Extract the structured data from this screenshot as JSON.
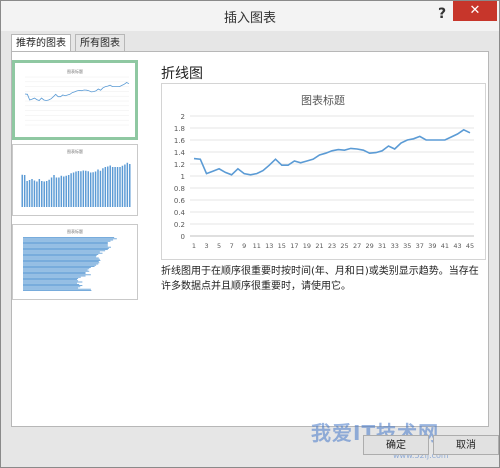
{
  "dialog": {
    "title": "插入图表",
    "help_label": "?",
    "close_label": "✕"
  },
  "tabs": [
    {
      "label": "推荐的图表",
      "active": true
    },
    {
      "label": "所有图表",
      "active": false
    }
  ],
  "thumbnails": [
    {
      "type": "line",
      "title": "图表标题",
      "selected": true
    },
    {
      "type": "column",
      "title": "图表标题",
      "selected": false
    },
    {
      "type": "bar",
      "title": "图表标题",
      "selected": false
    }
  ],
  "preview": {
    "chart_type_name": "折线图",
    "description": "折线图用于在顺序很重要时按时间(年、月和日)或类别显示趋势。当存在许多数据点并且顺序很重要时，请使用它。"
  },
  "chart_data": {
    "type": "line",
    "title": "图表标题",
    "xlabel": "",
    "ylabel": "",
    "x": [
      1,
      2,
      3,
      4,
      5,
      6,
      7,
      8,
      9,
      10,
      11,
      12,
      13,
      14,
      15,
      16,
      17,
      18,
      19,
      20,
      21,
      22,
      23,
      24,
      25,
      26,
      27,
      28,
      29,
      30,
      31,
      32,
      33,
      34,
      35,
      36,
      37,
      38,
      39,
      40,
      41,
      42,
      43,
      44,
      45
    ],
    "x_tick_labels": [
      "1",
      "3",
      "5",
      "7",
      "9",
      "11",
      "13",
      "15",
      "17",
      "19",
      "21",
      "23",
      "25",
      "27",
      "29",
      "31",
      "33",
      "35",
      "37",
      "39",
      "41",
      "43",
      "45"
    ],
    "y_tick_labels": [
      "0",
      "0.2",
      "0.4",
      "0.6",
      "0.8",
      "1",
      "1.2",
      "1.4",
      "1.6",
      "1.8",
      "2"
    ],
    "ylim": [
      0,
      2
    ],
    "series": [
      {
        "values": [
          1.29,
          1.28,
          1.04,
          1.08,
          1.12,
          1.06,
          1.02,
          1.12,
          1.04,
          1.02,
          1.04,
          1.09,
          1.18,
          1.28,
          1.18,
          1.18,
          1.25,
          1.22,
          1.25,
          1.28,
          1.35,
          1.38,
          1.42,
          1.44,
          1.43,
          1.46,
          1.45,
          1.43,
          1.38,
          1.39,
          1.42,
          1.5,
          1.45,
          1.55,
          1.6,
          1.62,
          1.66,
          1.6,
          1.6,
          1.6,
          1.6,
          1.65,
          1.7,
          1.77,
          1.72
        ],
        "color": "#5b9bd5"
      }
    ],
    "grid": true,
    "legend": "none"
  },
  "buttons": {
    "ok_label": "确定",
    "cancel_label": "取消"
  },
  "watermark": {
    "text": "我爱IT技术网",
    "sub": "www.52ij.com"
  }
}
